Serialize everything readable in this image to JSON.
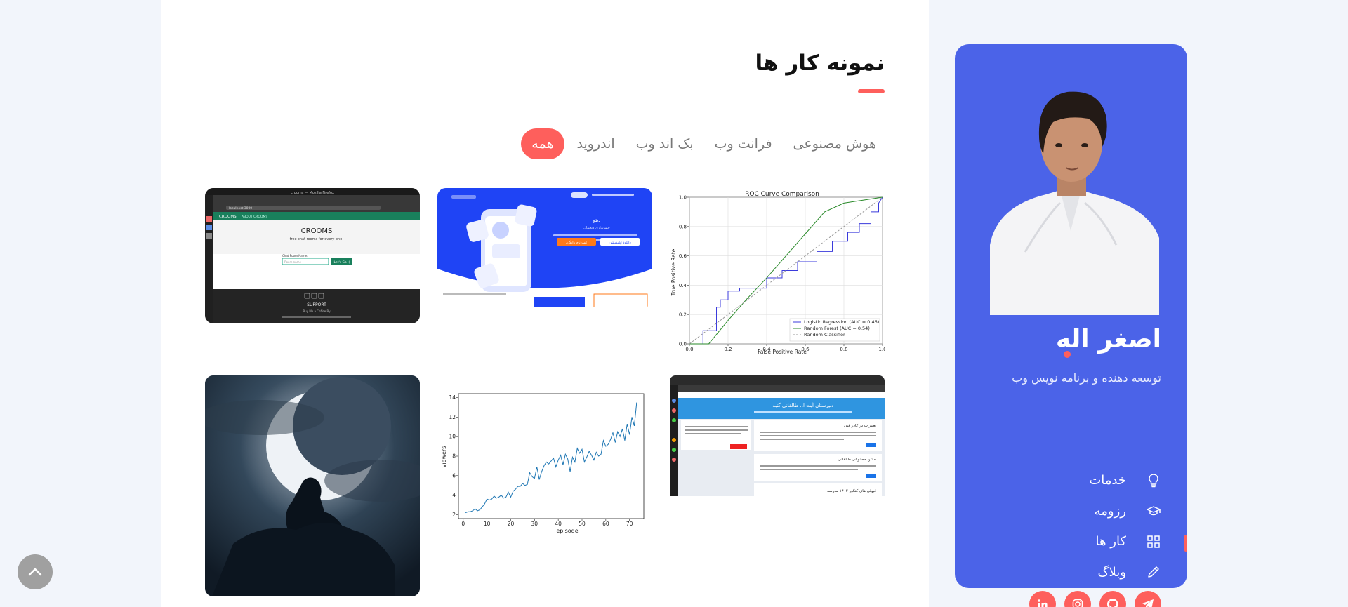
{
  "portfolio": {
    "title": "نمونه کار ها",
    "filters": [
      {
        "label": "همه",
        "active": true
      },
      {
        "label": "اندروید"
      },
      {
        "label": "بک اند وب"
      },
      {
        "label": "فرانت وب"
      },
      {
        "label": "هوش مصنوعی"
      }
    ],
    "items": [
      {
        "name": "roc-chart",
        "chart_data": {
          "type": "line",
          "title": "ROC Curve Comparison",
          "xlabel": "False Positive Rate",
          "ylabel": "True Positive Rate",
          "xlim": [
            0,
            1
          ],
          "ylim": [
            0,
            1
          ],
          "xticks": [
            "0.0",
            "0.2",
            "0.4",
            "0.6",
            "0.8",
            "1.0"
          ],
          "yticks": [
            "0.0",
            "0.2",
            "0.4",
            "0.6",
            "0.8",
            "1.0"
          ],
          "legend_position": "bottom-right",
          "grid": true,
          "series": [
            {
              "name": "Logistic Regression (AUC = 0.46)",
              "color": "#3b3bdc",
              "x": [
                0,
                0.07,
                0.07,
                0.14,
                0.14,
                0.16,
                0.16,
                0.2,
                0.2,
                0.26,
                0.26,
                0.4,
                0.4,
                0.48,
                0.48,
                0.56,
                0.56,
                0.66,
                0.66,
                0.74,
                0.74,
                0.82,
                0.82,
                0.88,
                0.88,
                0.94,
                0.94,
                0.98,
                0.98,
                1.0
              ],
              "y": [
                0,
                0,
                0.09,
                0.09,
                0.25,
                0.25,
                0.3,
                0.3,
                0.36,
                0.36,
                0.38,
                0.38,
                0.45,
                0.45,
                0.5,
                0.5,
                0.56,
                0.56,
                0.63,
                0.63,
                0.7,
                0.7,
                0.76,
                0.76,
                0.82,
                0.82,
                0.9,
                0.9,
                0.96,
                1.0
              ]
            },
            {
              "name": "Random Forest (AUC = 0.54)",
              "color": "#2a8a2a",
              "x": [
                0,
                0.1,
                0.2,
                0.3,
                0.4,
                0.5,
                0.6,
                0.7,
                0.8,
                1.0
              ],
              "y": [
                0,
                0,
                0.16,
                0.31,
                0.45,
                0.6,
                0.75,
                0.9,
                0.96,
                1.0
              ]
            },
            {
              "name": "Random Classifier",
              "color": "#999999",
              "style": "dashed",
              "x": [
                0,
                1
              ],
              "y": [
                0,
                1
              ]
            }
          ]
        }
      },
      {
        "name": "project-screenshot-web-landing",
        "hero_title": "دیتو",
        "hero_subtitle": "حسابداری دیجیتال",
        "buttons": [
          "دانلود اپلیکیشن",
          "ثبت نام رایگان"
        ]
      },
      {
        "name": "project-screenshot-crooms",
        "browser_title": "crooms — Mozilla Firefox",
        "url": "localhost:3000",
        "nav_brand": "CROOMS",
        "nav_link": "ABOUT CROOMS",
        "heading": "CROOMS",
        "subheading": "free chat rooms for every one!",
        "input_label": "Chat Room Name:",
        "input_placeholder": "Room name",
        "button_label": "Let's Go :)",
        "support_title": "SUPPORT",
        "support_text": "Buy Me a Coffee By"
      },
      {
        "name": "project-screenshot-school-site",
        "banner_title": "دبیرستان آیت ا.. طالقانی گنبد",
        "news_titles": [
          "تغییرات در کادر فنی",
          "جشن مصنوعی طالقانی",
          "قبولی های کنکور ۱۴۰۲ مدرسه"
        ]
      },
      {
        "name": "viewers-chart",
        "chart_data": {
          "type": "line",
          "xlabel": "episode",
          "ylabel": "viewers",
          "xlim": [
            -2,
            76
          ],
          "ylim": [
            1.6,
            14.4
          ],
          "xticks": [
            "0",
            "10",
            "20",
            "30",
            "40",
            "50",
            "60",
            "70"
          ],
          "yticks": [
            "2",
            "4",
            "6",
            "8",
            "10",
            "12",
            "14"
          ],
          "series": [
            {
              "color": "#1f77b4",
              "x": [
                1,
                2,
                3,
                4,
                5,
                6,
                7,
                8,
                9,
                10,
                11,
                12,
                13,
                14,
                15,
                16,
                17,
                18,
                19,
                20,
                21,
                22,
                23,
                24,
                25,
                26,
                27,
                28,
                29,
                30,
                31,
                32,
                33,
                34,
                35,
                36,
                37,
                38,
                39,
                40,
                41,
                42,
                43,
                44,
                45,
                46,
                47,
                48,
                49,
                50,
                51,
                52,
                53,
                54,
                55,
                56,
                57,
                58,
                59,
                60,
                61,
                62,
                63,
                64,
                65,
                66,
                67,
                68,
                69,
                70,
                71,
                72,
                73
              ],
              "y": [
                2.2,
                2.3,
                2.3,
                2.4,
                2.6,
                2.4,
                2.5,
                2.8,
                3.1,
                3.6,
                3.5,
                3.6,
                3.9,
                3.7,
                3.8,
                4.0,
                3.7,
                3.8,
                4.3,
                3.8,
                4.4,
                4.6,
                4.9,
                4.9,
                5.2,
                5.0,
                5.1,
                6.3,
                5.9,
                5.7,
                6.9,
                5.6,
                6.4,
                7.0,
                7.4,
                7.2,
                7.5,
                7.8,
                6.9,
                7.6,
                8.1,
                7.1,
                8.2,
                7.7,
                6.4,
                7.9,
                7.4,
                8.8,
                8.3,
                8.7,
                7.4,
                7.9,
                8.5,
                8.1,
                7.6,
                8.4,
                8.0,
                8.2,
                9.6,
                9.0,
                9.2,
                9.7,
                10.4,
                9.4,
                10.5,
                10.0,
                10.8,
                9.6,
                11.3,
                10.2,
                12.0,
                11.1,
                13.5
              ]
            }
          ]
        }
      },
      {
        "name": "moon-artwork"
      }
    ]
  },
  "profile": {
    "name": "اصغر اله",
    "tagline": "توسعه دهنده و برنامه نویس وب",
    "nav": [
      {
        "label": "خدمات",
        "icon": "lightbulb-icon"
      },
      {
        "label": "رزومه",
        "icon": "graduation-cap-icon"
      },
      {
        "label": "کار ها",
        "icon": "grid-icon",
        "active": true
      },
      {
        "label": "وبلاگ",
        "icon": "pencil-icon"
      }
    ],
    "socials": [
      "telegram-icon",
      "github-icon",
      "instagram-icon",
      "linkedin-icon"
    ]
  },
  "colors": {
    "accent": "#fe5f5c",
    "sidebar": "#4b63e8"
  }
}
